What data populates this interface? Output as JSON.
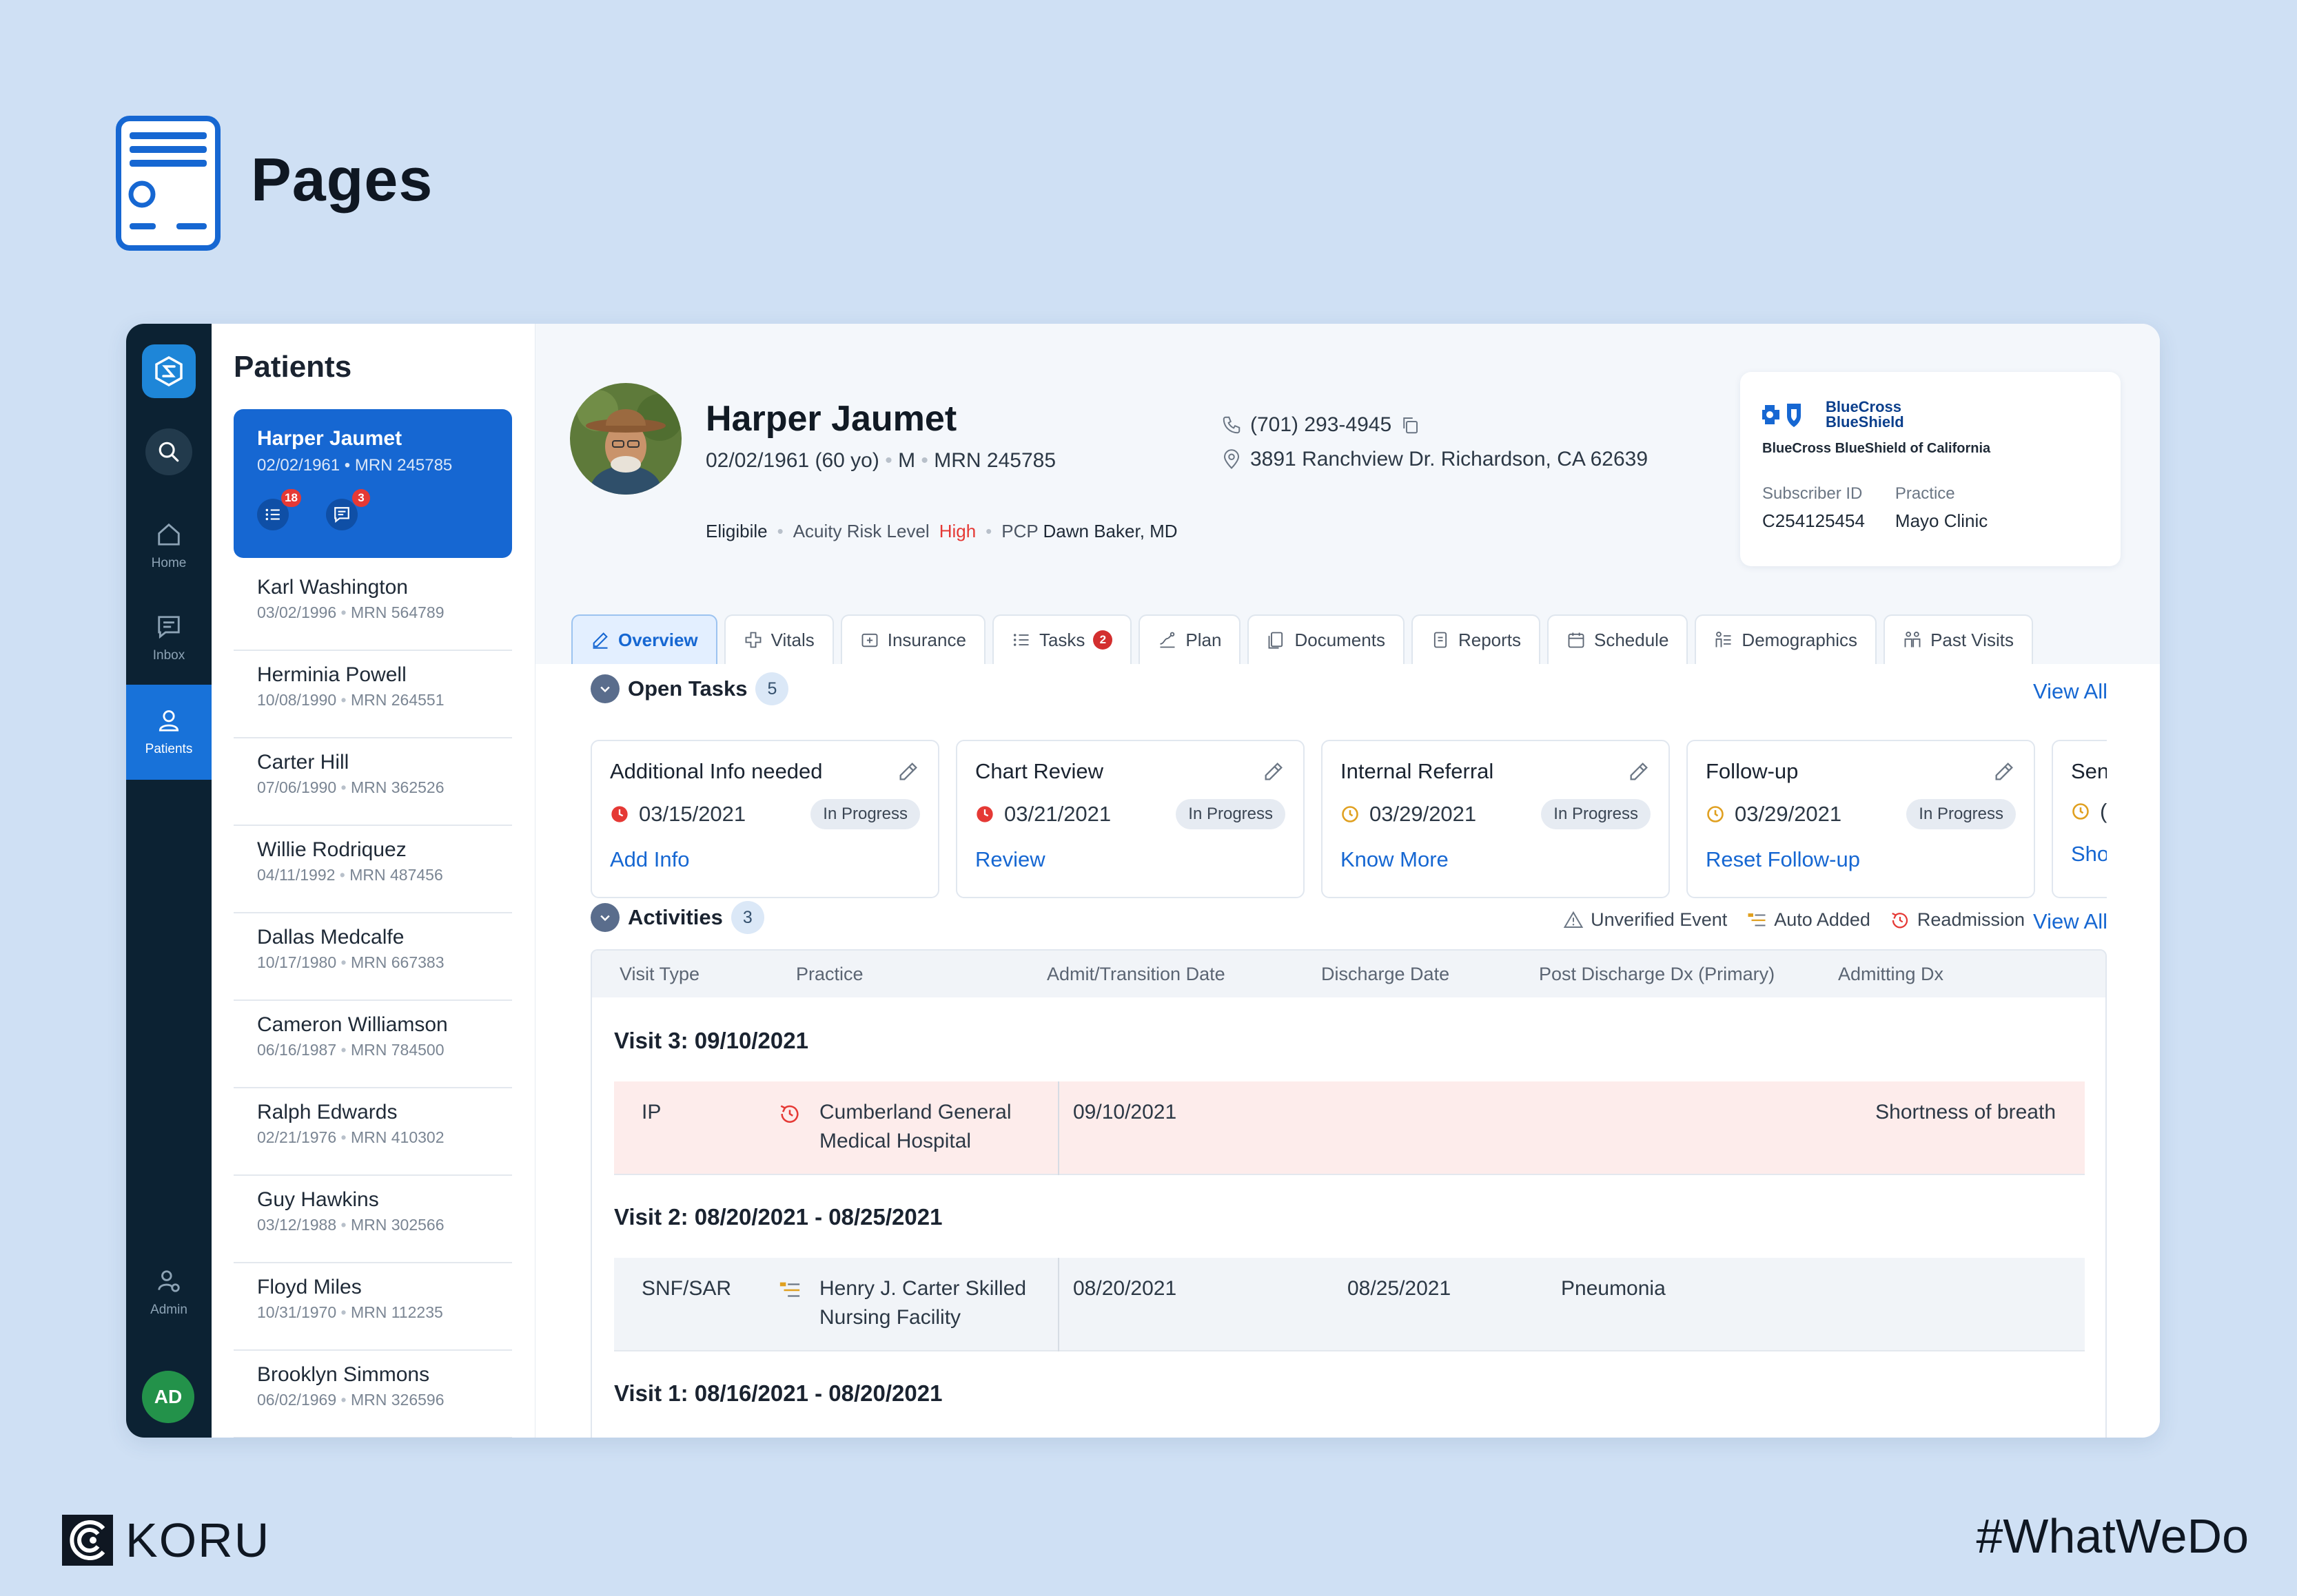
{
  "slide": {
    "title": "Pages",
    "brand": "KORU",
    "hashtag": "#WhatWeDo"
  },
  "rail": {
    "items": [
      {
        "label": "Home",
        "icon": "home-icon"
      },
      {
        "label": "Inbox",
        "icon": "inbox-icon"
      },
      {
        "label": "Patients",
        "icon": "user-icon",
        "active": true
      },
      {
        "label": "Admin",
        "icon": "admin-icon"
      }
    ],
    "avatar": "AD"
  },
  "patients": {
    "title": "Patients",
    "active": {
      "name": "Harper Jaumet",
      "meta": "02/02/1961 • MRN 245785",
      "tasks_count": "18",
      "messages_count": "3"
    },
    "list": [
      {
        "name": "Karl Washington",
        "dob": "03/02/1996",
        "mrn": "MRN 564789"
      },
      {
        "name": "Herminia Powell",
        "dob": "10/08/1990",
        "mrn": "MRN 264551"
      },
      {
        "name": "Carter Hill",
        "dob": "07/06/1990",
        "mrn": "MRN 362526"
      },
      {
        "name": "Willie Rodriquez",
        "dob": "04/11/1992",
        "mrn": "MRN 487456"
      },
      {
        "name": "Dallas Medcalfe",
        "dob": "10/17/1980",
        "mrn": "MRN 667383"
      },
      {
        "name": "Cameron Williamson",
        "dob": "06/16/1987",
        "mrn": "MRN 784500"
      },
      {
        "name": "Ralph Edwards",
        "dob": "02/21/1976",
        "mrn": "MRN 410302"
      },
      {
        "name": "Guy Hawkins",
        "dob": "03/12/1988",
        "mrn": "MRN 302566"
      },
      {
        "name": "Floyd Miles",
        "dob": "10/31/1970",
        "mrn": "MRN 112235"
      },
      {
        "name": "Brooklyn Simmons",
        "dob": "06/02/1969",
        "mrn": "MRN 326596"
      }
    ]
  },
  "patient": {
    "name": "Harper Jaumet",
    "dob": "02/02/1961 (60 yo)",
    "sex": "M",
    "mrn": "MRN 245785",
    "phone": "(701) 293-4945",
    "address": "3891 Ranchview Dr. Richardson, CA 62639",
    "eligibility": "Eligibile",
    "acuity_label": "Acuity Risk Level",
    "acuity_value": "High",
    "pcp_label": "PCP",
    "pcp_value": "Dawn Baker, MD"
  },
  "insurance": {
    "brand_name": "BlueCross BlueShield",
    "full_name": "BlueCross BlueShield of California",
    "subscriber_label": "Subscriber ID",
    "subscriber_id": "C254125454",
    "practice_label": "Practice",
    "practice": "Mayo Clinic"
  },
  "tabs": [
    {
      "label": "Overview",
      "icon": "pen-icon",
      "active": true
    },
    {
      "label": "Vitals",
      "icon": "vitals-icon"
    },
    {
      "label": "Insurance",
      "icon": "insurance-icon"
    },
    {
      "label": "Tasks",
      "icon": "list-icon",
      "badge": "2"
    },
    {
      "label": "Plan",
      "icon": "plan-icon"
    },
    {
      "label": "Documents",
      "icon": "documents-icon"
    },
    {
      "label": "Reports",
      "icon": "reports-icon"
    },
    {
      "label": "Schedule",
      "icon": "calendar-icon"
    },
    {
      "label": "Demographics",
      "icon": "demographics-icon"
    },
    {
      "label": "Past Visits",
      "icon": "people-icon"
    }
  ],
  "open_tasks": {
    "title": "Open Tasks",
    "count": "5",
    "view_all": "View All",
    "cards": [
      {
        "title": "Additional Info needed",
        "date": "03/15/2021",
        "status": "In Progress",
        "action": "Add Info",
        "date_icon": "red-clock"
      },
      {
        "title": "Chart Review",
        "date": "03/21/2021",
        "status": "In Progress",
        "action": "Review",
        "date_icon": "red-clock"
      },
      {
        "title": "Internal Referral",
        "date": "03/29/2021",
        "status": "In Progress",
        "action": "Know More",
        "date_icon": "amber-clock"
      },
      {
        "title": "Follow-up",
        "date": "03/29/2021",
        "status": "In Progress",
        "action": "Reset Follow-up",
        "date_icon": "amber-clock"
      },
      {
        "title": "Sen",
        "date": "(",
        "status": "",
        "action": "Sho",
        "date_icon": "amber-clock"
      }
    ]
  },
  "activities": {
    "title": "Activities",
    "count": "3",
    "view_all": "View All",
    "legend": [
      "Unverified Event",
      "Auto Added",
      "Readmission"
    ],
    "columns": [
      "Visit Type",
      "Practice",
      "Admit/Transition Date",
      "Discharge Date",
      "Post Discharge Dx (Primary)",
      "Admitting Dx"
    ],
    "visits": [
      {
        "heading": "Visit 3: 09/10/2021",
        "type": "IP",
        "practice_line1": "Cumberland General",
        "practice_line2": "Medical Hospital",
        "admit": "09/10/2021",
        "discharge": "",
        "post_dx": "",
        "admit_dx": "Shortness of breath"
      },
      {
        "heading": "Visit 2: 08/20/2021 - 08/25/2021",
        "type": "SNF/SAR",
        "practice_line1": "Henry J. Carter Skilled",
        "practice_line2": "Nursing Facility",
        "admit": "08/20/2021",
        "discharge": "08/25/2021",
        "post_dx": "Pneumonia",
        "admit_dx": ""
      },
      {
        "heading": "Visit 1: 08/16/2021 - 08/20/2021"
      }
    ]
  },
  "colors": {
    "accent": "#1667d2",
    "rail": "#0c2233",
    "background": "#cfe0f4",
    "alert": "#e53935"
  }
}
